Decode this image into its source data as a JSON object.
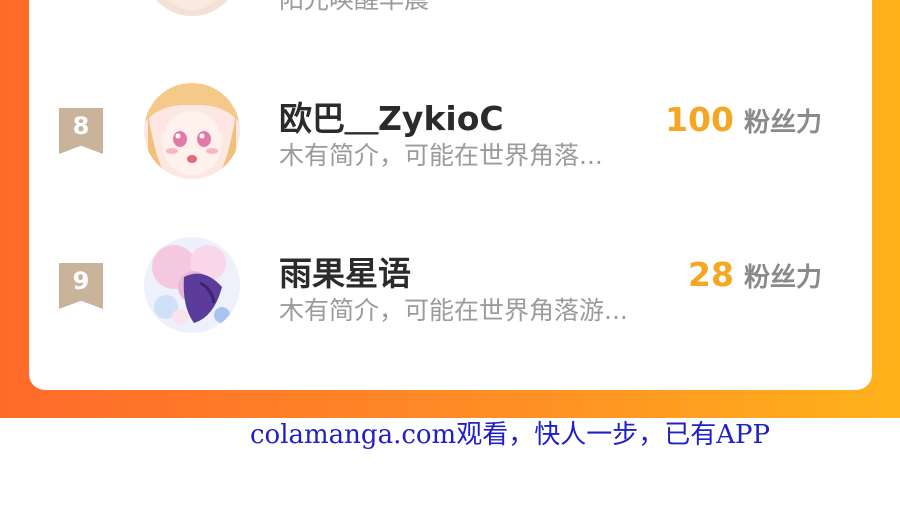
{
  "top_partial": {
    "desc": "阳光唤醒早晨"
  },
  "rows": [
    {
      "rank": "8",
      "name": "欧巴＿ZykioC",
      "desc": "木有简介，可能在世界角落...",
      "fans_count": "100",
      "fans_label": "粉丝力"
    },
    {
      "rank": "9",
      "name": "雨果星语",
      "desc": "木有简介，可能在世界角落游...",
      "fans_count": "28",
      "fans_label": "粉丝力"
    }
  ],
  "watermark": "colamanga.com观看，快人一步，已有APP",
  "colors": {
    "gradient_left": "#ff6a2a",
    "gradient_right": "#ffb21a",
    "rank_badge": "#c9b39b",
    "fans_count": "#f5a623",
    "watermark": "#2020c8"
  }
}
